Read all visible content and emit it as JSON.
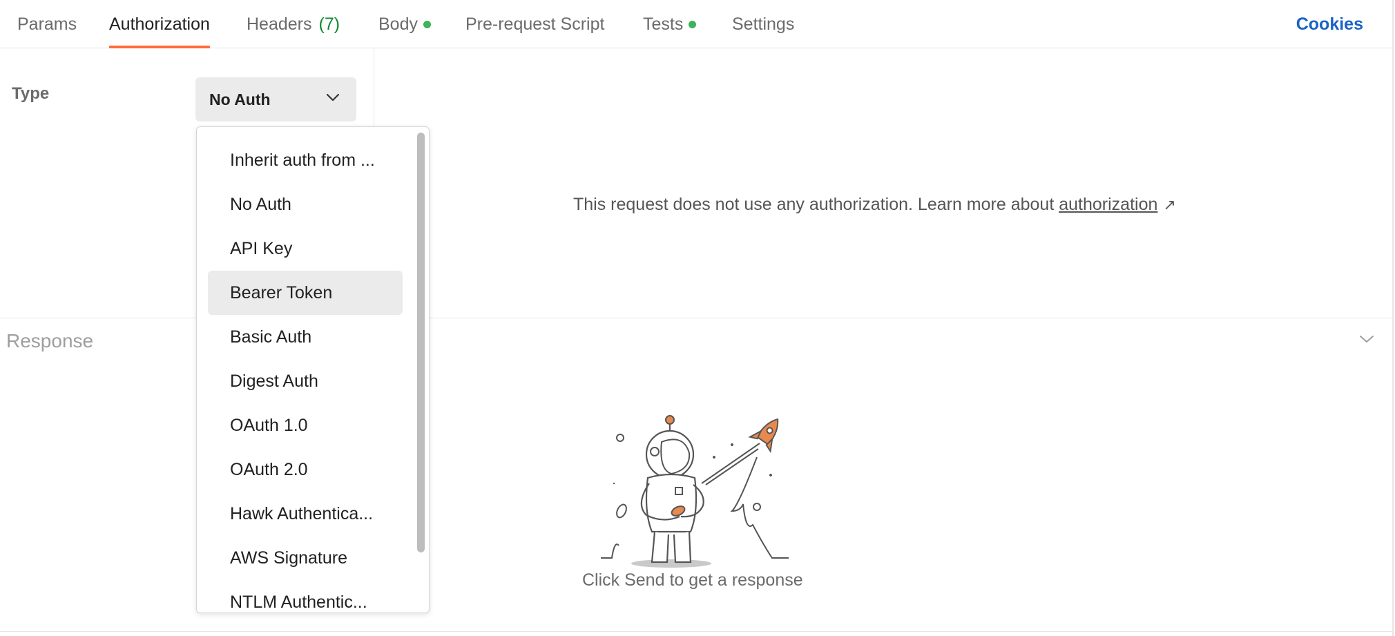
{
  "tabs": [
    {
      "label": "Params"
    },
    {
      "label": "Authorization",
      "active": true
    },
    {
      "label": "Headers",
      "count": "(7)"
    },
    {
      "label": "Body",
      "dot": true
    },
    {
      "label": "Pre-request Script"
    },
    {
      "label": "Tests",
      "dot": true
    },
    {
      "label": "Settings"
    }
  ],
  "cookies_label": "Cookies",
  "auth": {
    "type_label": "Type",
    "selected_type": "No Auth",
    "message": "This request does not use any authorization. Learn more about",
    "link_text": "authorization",
    "link_icon": "external-arrow-icon"
  },
  "dropdown": {
    "items": [
      "Inherit auth from ...",
      "No Auth",
      "API Key",
      "Bearer Token",
      "Basic Auth",
      "Digest Auth",
      "OAuth 1.0",
      "OAuth 2.0",
      "Hawk Authentica...",
      "AWS Signature",
      "NTLM Authentic..."
    ],
    "highlighted_index": 3
  },
  "response": {
    "label": "Response",
    "empty_message": "Click Send to get a response"
  },
  "colors": {
    "accent": "#ff6c37",
    "link_blue": "#1a62c5",
    "status_green": "#3cb35c"
  }
}
